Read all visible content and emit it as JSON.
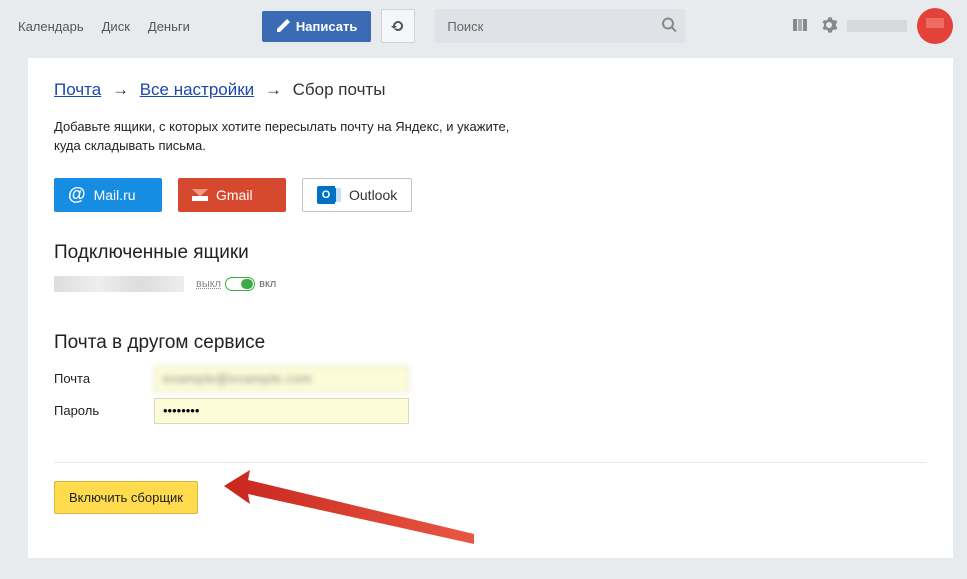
{
  "header": {
    "links": {
      "calendar": "Календарь",
      "disk": "Диск",
      "money": "Деньги"
    },
    "compose": "Написать",
    "search_placeholder": "Поиск"
  },
  "breadcrumb": {
    "mail": "Почта",
    "all_settings": "Все настройки",
    "current": "Сбор почты"
  },
  "desc_line1": "Добавьте ящики, с которых хотите пересылать почту на Яндекс, и укажите,",
  "desc_line2": "куда складывать письма.",
  "providers": {
    "mailru": "Mail.ru",
    "gmail": "Gmail",
    "outlook": "Outlook"
  },
  "connected": {
    "title": "Подключенные ящики",
    "off": "выкл",
    "on": "вкл"
  },
  "other_service": {
    "title": "Почта в другом сервисе",
    "email_label": "Почта",
    "password_label": "Пароль",
    "email_value": "example@example.com",
    "password_value": "••••••••"
  },
  "submit": "Включить сборщик"
}
